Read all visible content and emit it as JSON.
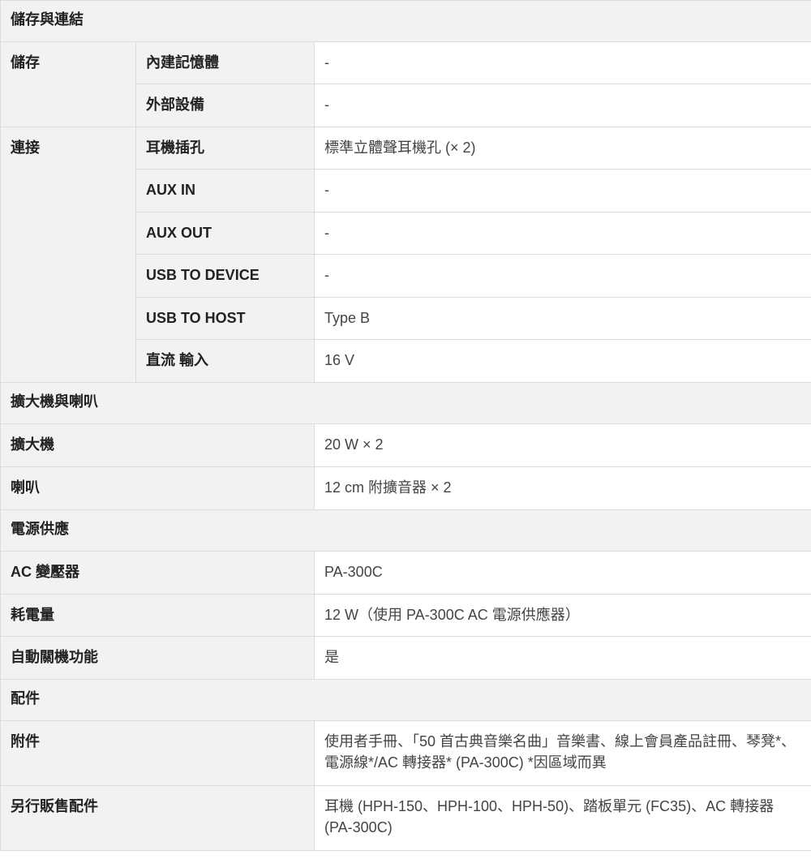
{
  "sections": {
    "storage_connect": "儲存與連結",
    "amp_speaker": "擴大機與喇叭",
    "power": "電源供應",
    "accessories": "配件"
  },
  "storage": {
    "label": "儲存",
    "rows": [
      {
        "name": "內建記憶體",
        "value": "-"
      },
      {
        "name": "外部設備",
        "value": "-"
      }
    ]
  },
  "connect": {
    "label": "連接",
    "rows": [
      {
        "name": "耳機插孔",
        "value": "標準立體聲耳機孔 (× 2)"
      },
      {
        "name": "AUX IN",
        "value": "-"
      },
      {
        "name": "AUX OUT",
        "value": "-"
      },
      {
        "name": "USB TO DEVICE",
        "value": "-"
      },
      {
        "name": "USB TO HOST",
        "value": "Type B"
      },
      {
        "name": "直流 輸入",
        "value": "16 V"
      }
    ]
  },
  "amp": {
    "rows": [
      {
        "name": "擴大機",
        "value": "20 W × 2"
      },
      {
        "name": "喇叭",
        "value": "12 cm 附擴音器 × 2"
      }
    ]
  },
  "power_rows": [
    {
      "name": "AC 變壓器",
      "value": "PA-300C"
    },
    {
      "name": "耗電量",
      "value": "12 W（使用 PA-300C AC 電源供應器）"
    },
    {
      "name": "自動關機功能",
      "value": "是"
    }
  ],
  "accessory_rows": [
    {
      "name": "附件",
      "value": "使用者手冊、「50 首古典音樂名曲」音樂書、線上會員產品註冊、琴凳*、電源線*/AC 轉接器* (PA-300C) *因區域而異"
    },
    {
      "name": "另行販售配件",
      "value": "耳機 (HPH-150、HPH-100、HPH-50)、踏板單元 (FC35)、AC 轉接器 (PA-300C)"
    }
  ]
}
